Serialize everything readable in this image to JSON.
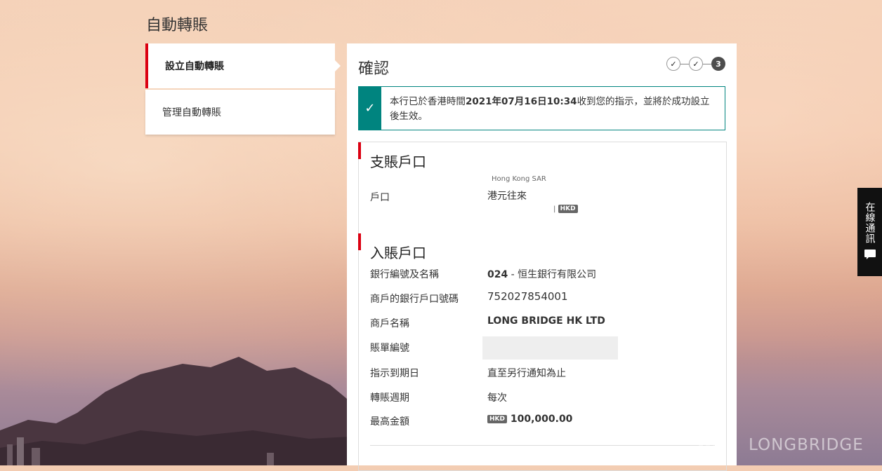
{
  "page": {
    "title": "自動轉賬"
  },
  "sidebar": {
    "items": [
      {
        "label": "設立自動轉賬",
        "active": true
      },
      {
        "label": "管理自動轉賬",
        "active": false
      }
    ]
  },
  "panel": {
    "title": "確認",
    "steps": [
      "✓",
      "✓",
      "3"
    ],
    "notice": {
      "part1": "本行已於香港時間",
      "datetime": "2021年07月16日10:34",
      "part2": "收到您的指示，並將於成功設立後生效。"
    }
  },
  "debit_account": {
    "section_title": "支賬戶口",
    "account_label": "戶口",
    "region": "Hong Kong SAR",
    "account_type": "港元往來",
    "currency_badge": "HKD"
  },
  "credit_account": {
    "section_title": "入賬戶口",
    "rows": [
      {
        "label": "銀行編號及名稱",
        "value_bold": "024",
        "value_rest": " - 恒生銀行有限公司"
      },
      {
        "label": "商戶的銀行戶口號碼",
        "value": "752027854001"
      },
      {
        "label": "商戶名稱",
        "value": "LONG BRIDGE HK LTD"
      },
      {
        "label": "賬單編號",
        "value": ""
      },
      {
        "label": "指示到期日",
        "value": "直至另行通知為止"
      },
      {
        "label": "轉賬週期",
        "value": "每次"
      },
      {
        "label": "最高金額",
        "currency": "HKD",
        "value": "100,000.00"
      }
    ]
  },
  "chat": {
    "label": "在線通訊"
  },
  "watermark": {
    "text": "LONGBRIDGE"
  },
  "colors": {
    "accent_red": "#db0011",
    "success_teal": "#00847f"
  }
}
